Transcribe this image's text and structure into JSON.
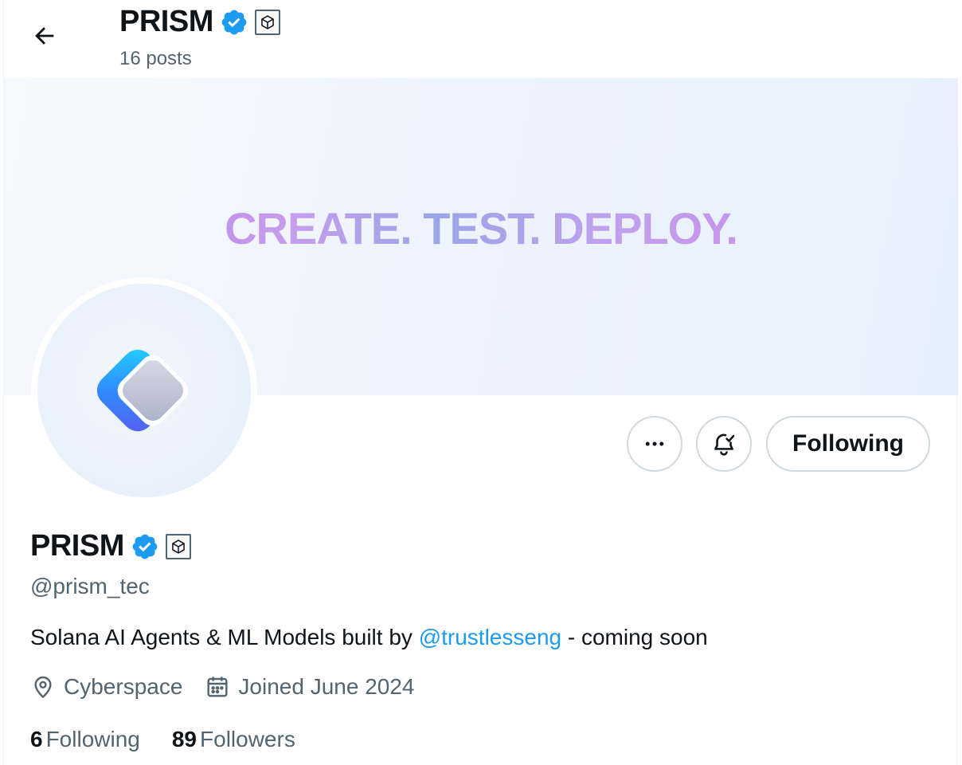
{
  "header": {
    "name": "PRISM",
    "post_count": "16 posts"
  },
  "banner": {
    "text": "CREATE. TEST. DEPLOY."
  },
  "actions": {
    "following_label": "Following"
  },
  "profile": {
    "name": "PRISM",
    "handle": "@prism_tec",
    "bio_prefix": "Solana AI Agents & ML Models built by ",
    "bio_mention": "@trustlesseng",
    "bio_suffix": " - coming soon",
    "location": "Cyberspace",
    "joined": "Joined June 2024"
  },
  "stats": {
    "following_count": "6",
    "following_label": "Following",
    "followers_count": "89",
    "followers_label": "Followers"
  },
  "icons": {
    "back": "arrow-left-icon",
    "verified": "verified-badge-icon",
    "affiliate": "cube-icon",
    "more": "more-dots-icon",
    "notify": "bell-check-icon",
    "location": "map-pin-icon",
    "calendar": "calendar-icon"
  },
  "colors": {
    "accent": "#1d9bf0",
    "text_primary": "#0f1419",
    "text_secondary": "#536471",
    "border": "#cfd9de"
  }
}
